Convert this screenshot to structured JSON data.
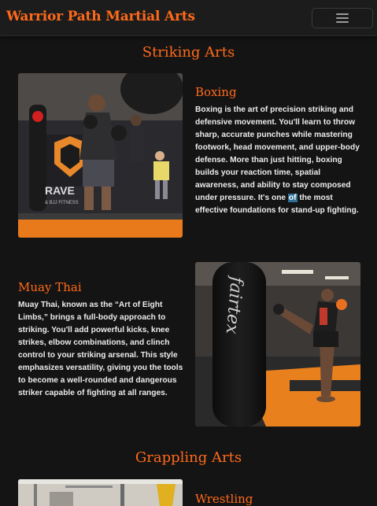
{
  "nav": {
    "brand": "Warrior Path Martial Arts",
    "toggle_icon": "hamburger-menu-icon"
  },
  "sections": {
    "striking_title": "Striking Arts",
    "grappling_title": "Grappling Arts"
  },
  "boxing": {
    "title": "Boxing",
    "text_before": "Boxing is the art of precision striking and defensive movement. You'll learn to throw sharp, accurate punches while mastering footwork, head movement, and upper-body defense. More than just hitting, boxing builds your reaction time, spatial awareness, and ability to stay composed under pressure. It's one ",
    "text_highlight": "of",
    "text_after": " the most effective foundations for stand-up fighting.",
    "image_sign": "RAVE",
    "image_sign_sub": "& BJJ FITNESS"
  },
  "muay_thai": {
    "title": "Muay Thai",
    "text": "Muay Thai, known as the “Art of Eight Limbs,” brings a full-body approach to striking. You'll add powerful kicks, knee strikes, elbow combinations, and clinch control to your striking arsenal. This style emphasizes versatility, giving you the tools to become a well-rounded and dangerous striker capable of fighting at all ranges.",
    "bag_text": "fairtex"
  },
  "wrestling": {
    "title": "Wrestling"
  },
  "colors": {
    "accent": "#ff6a1a",
    "background": "#141414",
    "highlight": "#2f6f95"
  }
}
